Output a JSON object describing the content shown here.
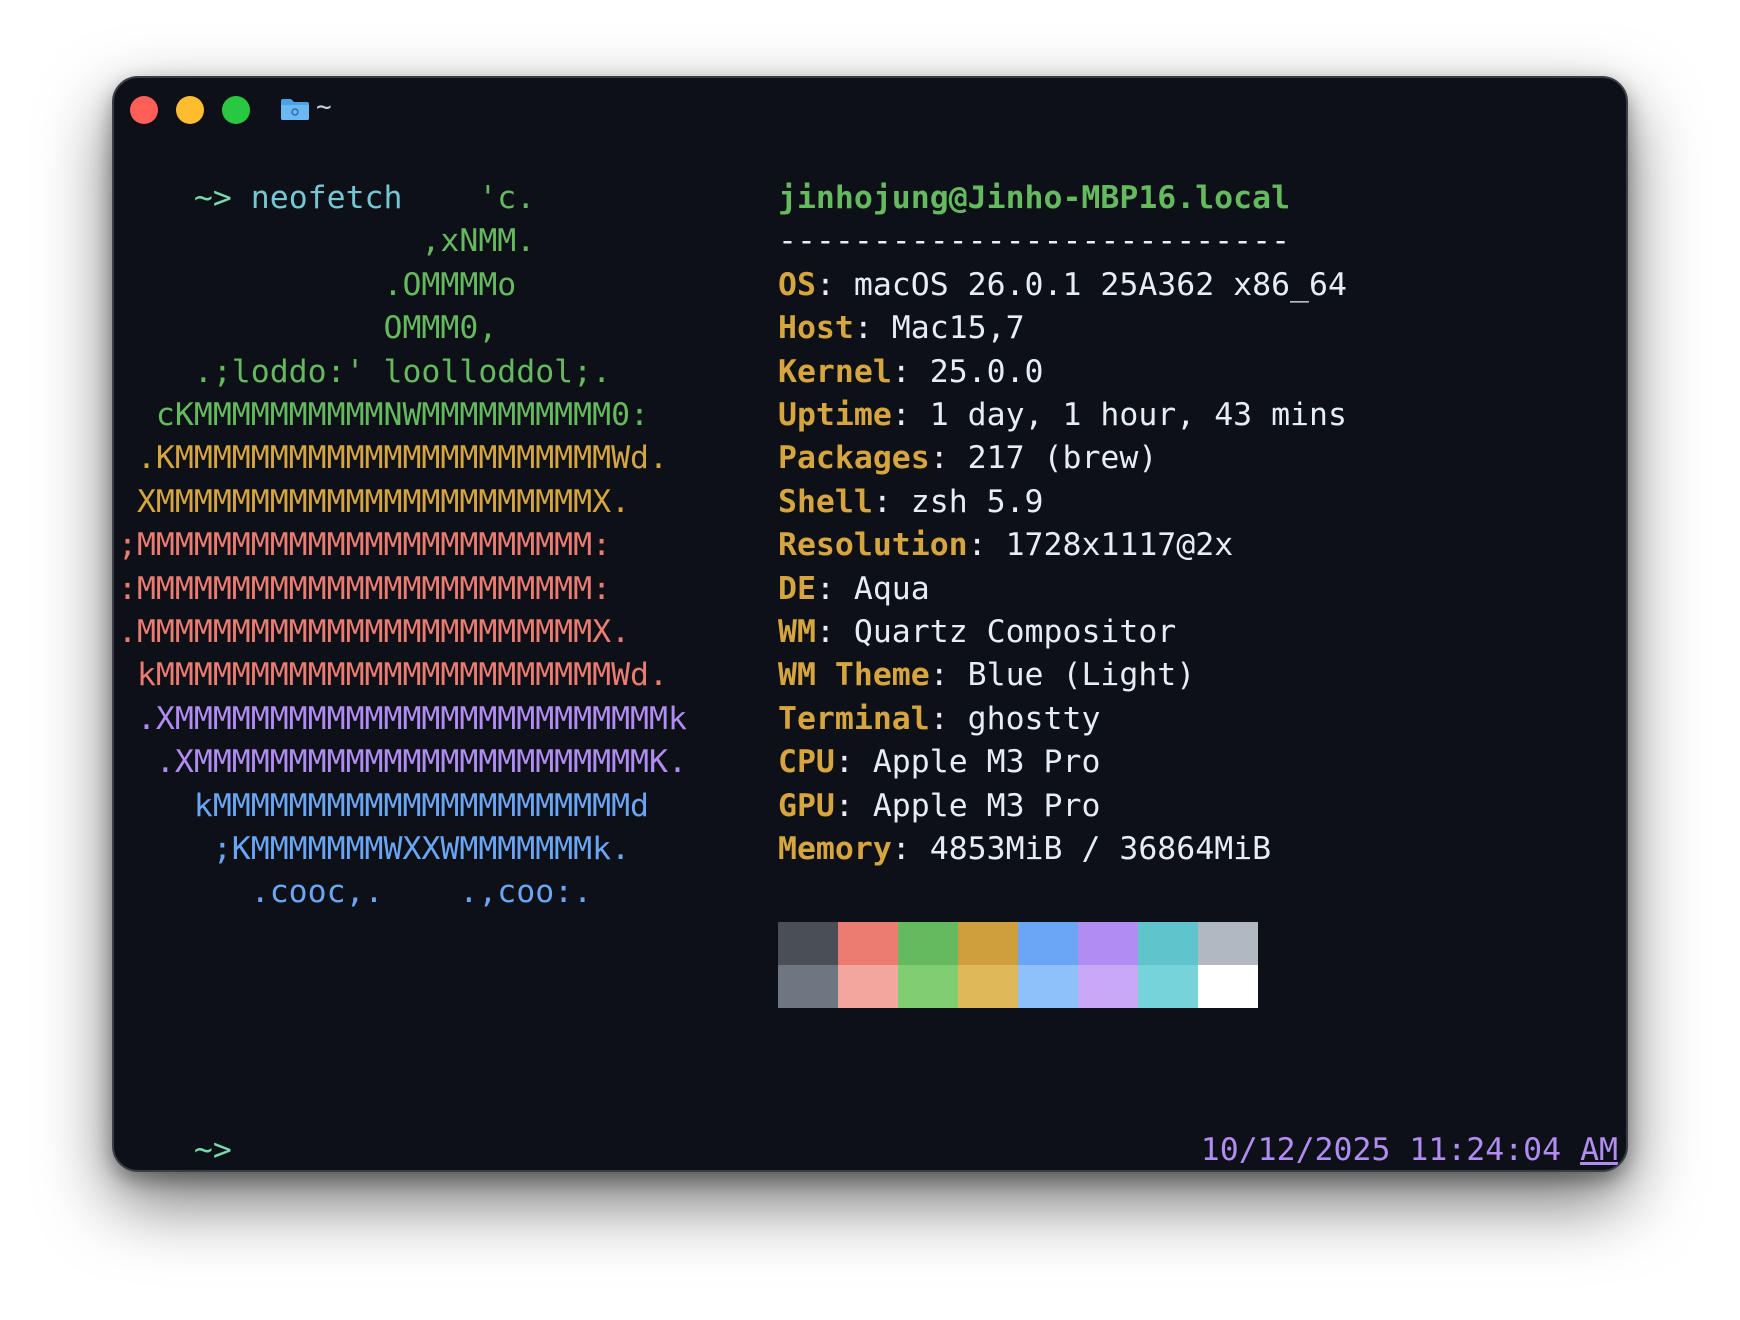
{
  "window": {
    "title": "~"
  },
  "command": {
    "prompt": "~>",
    "text": "neofetch"
  },
  "logo_lines": [
    {
      "text": "                   'c.",
      "color": "g"
    },
    {
      "text": "                ,xNMM.",
      "color": "g"
    },
    {
      "text": "              .OMMMMo",
      "color": "g"
    },
    {
      "text": "              OMMM0,",
      "color": "g"
    },
    {
      "text": "    .;loddo:' loolloddol;.",
      "color": "g"
    },
    {
      "text": "  cKMMMMMMMMMMNWMMMMMMMMMM0:",
      "color": "g"
    },
    {
      "text": " .KMMMMMMMMMMMMMMMMMMMMMMMWd.",
      "color": "y"
    },
    {
      "text": " XMMMMMMMMMMMMMMMMMMMMMMMX.",
      "color": "y"
    },
    {
      "text": ";MMMMMMMMMMMMMMMMMMMMMMMM:",
      "color": "r"
    },
    {
      "text": ":MMMMMMMMMMMMMMMMMMMMMMMM:",
      "color": "r"
    },
    {
      "text": ".MMMMMMMMMMMMMMMMMMMMMMMMX.",
      "color": "r"
    },
    {
      "text": " kMMMMMMMMMMMMMMMMMMMMMMMMWd.",
      "color": "r"
    },
    {
      "text": " .XMMMMMMMMMMMMMMMMMMMMMMMMMMk",
      "color": "p"
    },
    {
      "text": "  .XMMMMMMMMMMMMMMMMMMMMMMMMK.",
      "color": "p"
    },
    {
      "text": "    kMMMMMMMMMMMMMMMMMMMMMMd",
      "color": "b"
    },
    {
      "text": "     ;KMMMMMMMWXXWMMMMMMMk.",
      "color": "b"
    },
    {
      "text": "       .cooc,.    .,coo:.",
      "color": "b"
    }
  ],
  "info": {
    "user_host": "jinhojung@Jinho-MBP16.local",
    "separator": "---------------------------",
    "fields": [
      {
        "key": "OS",
        "value": "macOS 26.0.1 25A362 x86_64"
      },
      {
        "key": "Host",
        "value": "Mac15,7"
      },
      {
        "key": "Kernel",
        "value": "25.0.0"
      },
      {
        "key": "Uptime",
        "value": "1 day, 1 hour, 43 mins"
      },
      {
        "key": "Packages",
        "value": "217 (brew)"
      },
      {
        "key": "Shell",
        "value": "zsh 5.9"
      },
      {
        "key": "Resolution",
        "value": "1728x1117@2x"
      },
      {
        "key": "DE",
        "value": "Aqua"
      },
      {
        "key": "WM",
        "value": "Quartz Compositor"
      },
      {
        "key": "WM Theme",
        "value": "Blue (Light)"
      },
      {
        "key": "Terminal",
        "value": "ghostty"
      },
      {
        "key": "CPU",
        "value": "Apple M3 Pro"
      },
      {
        "key": "GPU",
        "value": "Apple M3 Pro"
      },
      {
        "key": "Memory",
        "value": "4853MiB / 36864MiB"
      }
    ]
  },
  "palette": {
    "normal": [
      "#4a4f57",
      "#ec7b71",
      "#65b95f",
      "#cf9f3d",
      "#6aa6f5",
      "#b18cf3",
      "#5fc4cc",
      "#b2b8c2"
    ],
    "bright": [
      "#6e7681",
      "#f3a69e",
      "#7fcf72",
      "#dfb85a",
      "#8ec0fa",
      "#c9a9f7",
      "#76d3da",
      "#ffffff"
    ]
  },
  "footer": {
    "prompt": "~>",
    "date_time": "10/12/2025 11:24:04",
    "ampm": "AM"
  }
}
